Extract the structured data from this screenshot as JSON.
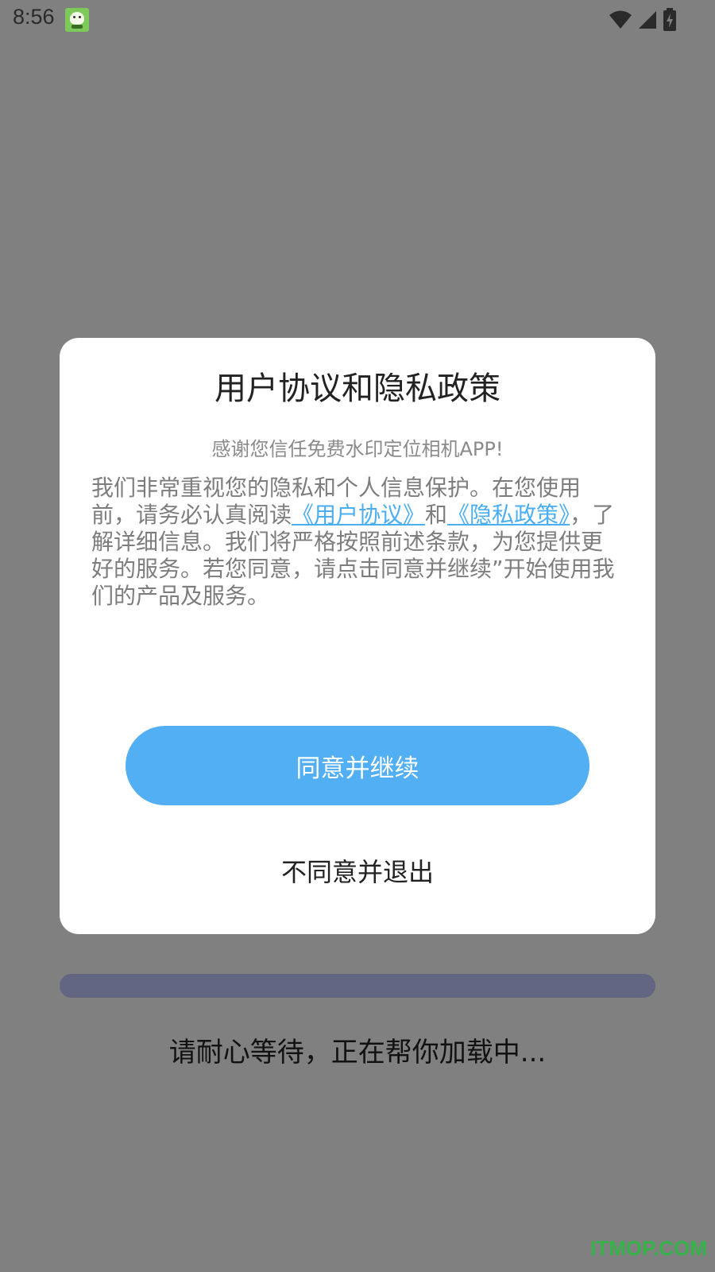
{
  "status_bar": {
    "time": "8:56",
    "icons": [
      "app-notification-icon",
      "wifi-icon",
      "cellular-signal-icon",
      "battery-charging-icon"
    ],
    "icon_color": "#2a2a2a"
  },
  "dialog": {
    "title": "用户协议和隐私政策",
    "subtitle": "感谢您信任免费水印定位相机APP!",
    "body": {
      "part1": "我们非常重视您的隐私和个人信息保护。在您使用前，请务必认真阅读",
      "link_user_agreement": "《用户协议》",
      "conjunction": "和",
      "link_privacy_policy": "《隐私政策》",
      "part2": "，了解详细信息。我们将严格按照前述条款，为您提供更好的服务。若您同意，请点击同意并继续”开始使用我们的产品及服务。"
    },
    "agree_button_label": "同意并继续",
    "disagree_button_label": "不同意并退出"
  },
  "loading": {
    "text": "请耐心等待，正在帮你加载中..."
  },
  "watermark": "ITMOP.COM",
  "colors": {
    "overlay": "#808080",
    "accent": "#52aff3",
    "link": "#4aaef0",
    "progress": "#636682",
    "watermark": "#35b34a"
  }
}
